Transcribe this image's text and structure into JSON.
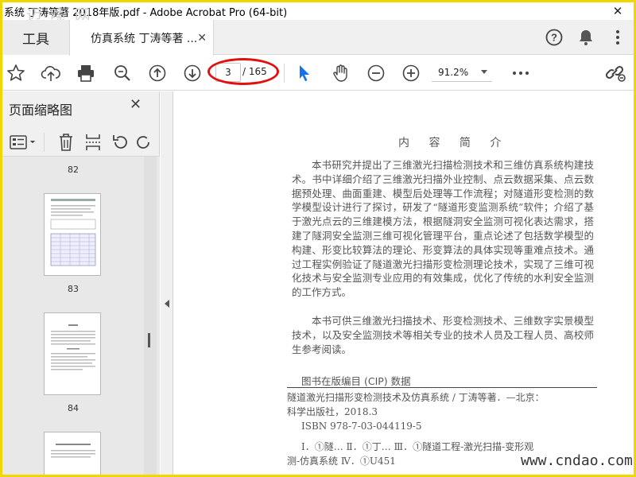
{
  "window": {
    "title": "系统 丁涛等著 2018年版.pdf - Adobe Acrobat Pro (64-bit)",
    "close_glyph": "✕",
    "watermark_top": "迈 嗦 网"
  },
  "tabs": {
    "tools_label": "工具",
    "doc_label": "仿真系统 丁涛等著 ...",
    "doc_close": "✕"
  },
  "toolbar": {
    "current_page": "3",
    "total_pages": "/ 165",
    "zoom": "91.2%"
  },
  "sidepanel": {
    "title": "页面缩略图",
    "close_glyph": "✕",
    "page_numbers": [
      "82",
      "83",
      "84"
    ]
  },
  "document": {
    "intro_title": "内 容 简 介",
    "paragraph1": "本书研究并提出了三维激光扫描检测技术和三维仿真系统构建技术。书中详细介绍了三维激光扫描外业控制、点云数据采集、点云数据预处理、曲面重建、模型后处理等工作流程；对隧道形变检测的数学模型设计进行了探讨，研发了“隧道形变监测系统”软件；介绍了基于激光点云的三维建模方法，根据隧洞安全监测可视化表达需求，搭建了隧洞安全监测三维可视化管理平台，重点论述了包括数学模型的构建、形变比较算法的理论、形变算法的具体实现等重难点技术。通过工程实例验证了隧道激光扫描形变检测理论技术，实现了三维可视化技术与安全监测专业应用的有效集成，优化了传统的水利安全监测的工作方式。",
    "paragraph2": "本书可供三维激光扫描技术、形变检测技术、三维数字实景模型技术，以及安全监测技术等相关专业的技术人员及工程人员、高校师生参考阅读。",
    "cip_title": "图书在版编目 (CIP) 数据",
    "cip_line1": "隧道激光扫描形变检测技术及仿真系统 / 丁涛等著．—北京：",
    "cip_line2": "科学出版社，2018.3",
    "cip_line3": "ISBN 978-7-03-044119-5",
    "cip_line4": "Ⅰ．①隧…  Ⅱ．①丁…  Ⅲ．①隧道工程-激光扫描-变形观",
    "cip_line5": "测-仿真系统  Ⅳ．①U451"
  },
  "watermark": "www.cndao.com",
  "colors": {
    "frame": "#f2d600",
    "accent_blue": "#1473e6",
    "annotation_red": "#e01010"
  }
}
